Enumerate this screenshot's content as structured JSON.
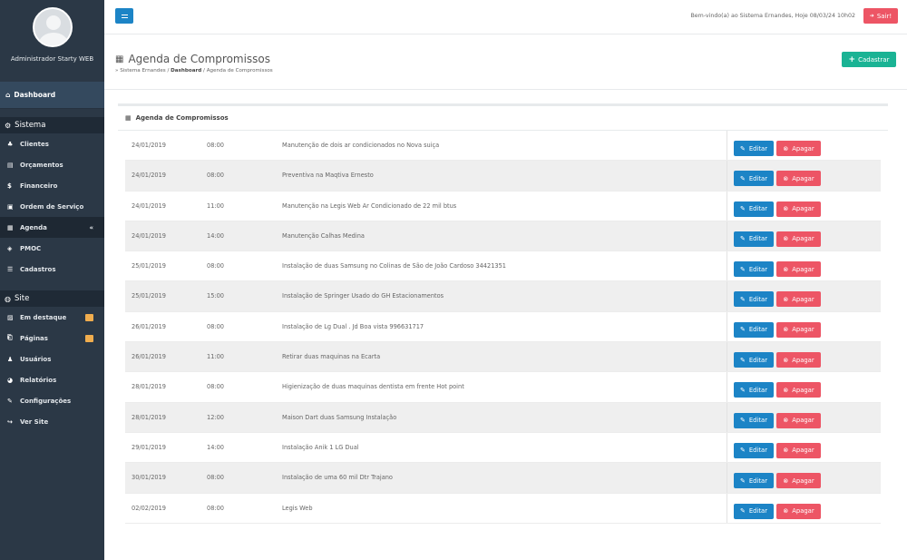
{
  "sidebar": {
    "profile_name": "Administrador Starty WEB",
    "dashboard": "Dashboard",
    "section_sistema": "Sistema",
    "items_sistema": [
      {
        "label": "Clientes",
        "icon": "users-icon"
      },
      {
        "label": "Orçamentos",
        "icon": "document-icon"
      },
      {
        "label": "Financeiro",
        "icon": "dollar-icon"
      },
      {
        "label": "Ordem de Serviço",
        "icon": "clipboard-icon"
      },
      {
        "label": "Agenda",
        "icon": "calendar-icon",
        "active": true
      },
      {
        "label": "PMOC",
        "icon": "layers-icon"
      },
      {
        "label": "Cadastros",
        "icon": "list-icon"
      }
    ],
    "section_site": "Site",
    "items_site": [
      {
        "label": "Em destaque",
        "icon": "image-icon",
        "badge": true
      },
      {
        "label": "Páginas",
        "icon": "pages-icon",
        "badge": true
      },
      {
        "label": "Usuários",
        "icon": "user-group-icon"
      },
      {
        "label": "Relatórios",
        "icon": "pie-chart-icon"
      },
      {
        "label": "Configurações",
        "icon": "wrench-icon"
      },
      {
        "label": "Ver Site",
        "icon": "share-icon"
      }
    ]
  },
  "topbar": {
    "welcome": "Bem-vindo(a) ao Sistema Ernandes, Hoje 08/03/24 10h02",
    "sair_label": "Sair!"
  },
  "heading": {
    "title": "Agenda de Compromissos",
    "crumb_root": "» Sistema Ernandes",
    "crumb_sep1": " / ",
    "crumb_mid": "Dashboard",
    "crumb_sep2": " / ",
    "crumb_leaf": "Agenda de Compromissos",
    "cadastrar_label": "Cadastrar"
  },
  "panel": {
    "title": "Agenda de Compromissos",
    "edit_label": "Editar",
    "delete_label": "Apagar",
    "rows": [
      {
        "date": "24/01/2019",
        "time": "08:00",
        "desc": "Manutenção de dois ar condicionados no Nova suiça"
      },
      {
        "date": "24/01/2019",
        "time": "08:00",
        "desc": "Preventiva na Maqtiva Ernesto"
      },
      {
        "date": "24/01/2019",
        "time": "11:00",
        "desc": "Manutenção na Legis Web Ar Condicionado de 22 mil btus"
      },
      {
        "date": "24/01/2019",
        "time": "14:00",
        "desc": "Manutenção Calhas Medina"
      },
      {
        "date": "25/01/2019",
        "time": "08:00",
        "desc": "Instalação de duas Samsung no Colinas de São de João Cardoso 34421351"
      },
      {
        "date": "25/01/2019",
        "time": "15:00",
        "desc": "Instalação de Springer Usado do GH Estacionamentos"
      },
      {
        "date": "26/01/2019",
        "time": "08:00",
        "desc": "Instalação de Lg Dual . Jd Boa vista 996631717"
      },
      {
        "date": "26/01/2019",
        "time": "11:00",
        "desc": "Retirar duas maquinas na Ecarta"
      },
      {
        "date": "28/01/2019",
        "time": "08:00",
        "desc": "Higienização de duas maquinas dentista em frente Hot point"
      },
      {
        "date": "28/01/2019",
        "time": "12:00",
        "desc": "Maison Dart duas Samsung Instalação"
      },
      {
        "date": "29/01/2019",
        "time": "14:00",
        "desc": "Instalação Anik 1 LG Dual"
      },
      {
        "date": "30/01/2019",
        "time": "08:00",
        "desc": "Instalação de uma 60 mil Dtr Trajano"
      },
      {
        "date": "02/02/2019",
        "time": "08:00",
        "desc": "Legis Web"
      }
    ]
  },
  "colors": {
    "sidebar_bg": "#2b3846",
    "primary": "#1c84c6",
    "danger": "#ed5565",
    "success": "#1ab394"
  }
}
